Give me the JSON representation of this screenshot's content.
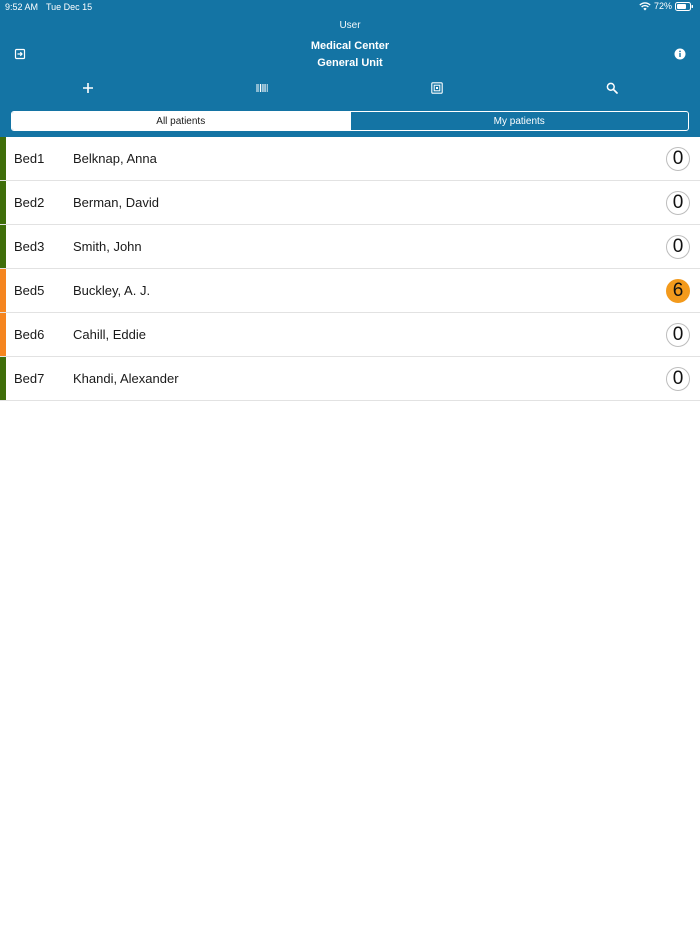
{
  "status_bar": {
    "time": "9:52 AM",
    "date": "Tue Dec 15",
    "battery": "72%"
  },
  "header": {
    "user": "User",
    "facility": "Medical Center",
    "unit": "General Unit"
  },
  "toolbar": {
    "icons": [
      "logout-icon",
      "info-icon",
      "plus-icon",
      "barcode-icon",
      "scan-icon",
      "search-icon"
    ]
  },
  "tabs": {
    "all": "All patients",
    "mine": "My patients"
  },
  "colors": {
    "header": "#1474a4",
    "status_ok": "#3f6e0a",
    "status_warning": "#f5851f",
    "badge_alert": "#f39a1c"
  },
  "patients": [
    {
      "bed": "Bed1",
      "name": "Belknap, Anna",
      "count": "0",
      "status": "ok"
    },
    {
      "bed": "Bed2",
      "name": "Berman, David",
      "count": "0",
      "status": "ok"
    },
    {
      "bed": "Bed3",
      "name": "Smith, John",
      "count": "0",
      "status": "ok"
    },
    {
      "bed": "Bed5",
      "name": "Buckley, A. J.",
      "count": "6",
      "status": "warning"
    },
    {
      "bed": "Bed6",
      "name": "Cahill, Eddie",
      "count": "0",
      "status": "warning"
    },
    {
      "bed": "Bed7",
      "name": "Khandi, Alexander",
      "count": "0",
      "status": "ok"
    }
  ]
}
